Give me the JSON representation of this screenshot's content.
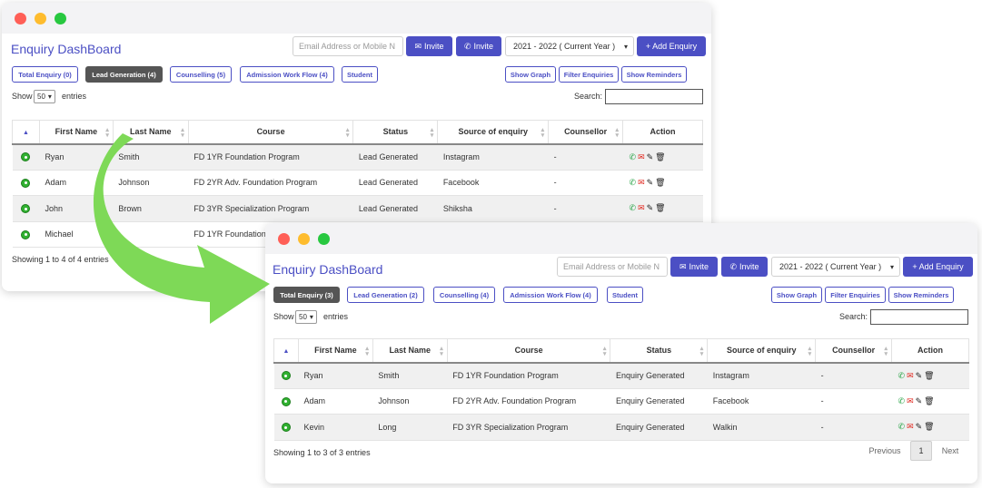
{
  "back": {
    "title": "Enquiry DashBoard",
    "email_placeholder": "Email Address or Mobile N",
    "invite_email_label": "Invite",
    "invite_whatsapp_label": "Invite",
    "year_select": "2021 - 2022 ( Current Year )",
    "add_label": "+ Add Enquiry",
    "tabs": [
      "Total Enquiry (0)",
      "Lead Generation (4)",
      "Counselling (5)",
      "Admission Work Flow (4)",
      "Student"
    ],
    "right_buttons": [
      "Show Graph",
      "Filter Enquiries",
      "Show Reminders"
    ],
    "show_label": "Show",
    "entries_select": "50",
    "entries_label": "entries",
    "search_label": "Search:",
    "columns": [
      "First Name",
      "Last Name",
      "Course",
      "Status",
      "Source of enquiry",
      "Counsellor",
      "Action"
    ],
    "rows": [
      {
        "first": "Ryan",
        "last": "Smith",
        "course": "FD 1YR Foundation Program",
        "status": "Lead Generated",
        "source": "Instagram",
        "counsellor": "-"
      },
      {
        "first": "Adam",
        "last": "Johnson",
        "course": "FD 2YR Adv. Foundation Program",
        "status": "Lead Generated",
        "source": "Facebook",
        "counsellor": "-"
      },
      {
        "first": "John",
        "last": "Brown",
        "course": "FD 3YR Specialization Program",
        "status": "Lead Generated",
        "source": "Shiksha",
        "counsellor": "-"
      },
      {
        "first": "Michael",
        "last": "",
        "course": "FD 1YR Foundation",
        "status": "",
        "source": "",
        "counsellor": ""
      }
    ],
    "footer": "Showing 1 to 4 of 4 entries"
  },
  "front": {
    "title": "Enquiry DashBoard",
    "email_placeholder": "Email Address or Mobile N",
    "invite_email_label": "Invite",
    "invite_whatsapp_label": "Invite",
    "year_select": "2021 - 2022 ( Current Year )",
    "add_label": "+ Add Enquiry",
    "tabs": [
      "Total Enquiry (3)",
      "Lead Generation (2)",
      "Counselling (4)",
      "Admission Work Flow (4)",
      "Student"
    ],
    "right_buttons": [
      "Show Graph",
      "Filter Enquiries",
      "Show Reminders"
    ],
    "show_label": "Show",
    "entries_select": "50",
    "entries_label": "entries",
    "search_label": "Search:",
    "columns": [
      "First Name",
      "Last Name",
      "Course",
      "Status",
      "Source of enquiry",
      "Counsellor",
      "Action"
    ],
    "rows": [
      {
        "first": "Ryan",
        "last": "Smith",
        "course": "FD 1YR Foundation Program",
        "status": "Enquiry Generated",
        "source": "Instagram",
        "counsellor": "-"
      },
      {
        "first": "Adam",
        "last": "Johnson",
        "course": "FD 2YR Adv. Foundation Program",
        "status": "Enquiry Generated",
        "source": "Facebook",
        "counsellor": "-"
      },
      {
        "first": "Kevin",
        "last": "Long",
        "course": "FD 3YR Specialization Program",
        "status": "Enquiry Generated",
        "source": "Walkin",
        "counsellor": "-"
      }
    ],
    "footer": "Showing 1 to 3 of 3 entries",
    "pager": {
      "previous": "Previous",
      "current": "1",
      "next": "Next"
    }
  },
  "colors": {
    "accent": "#4b4fc4",
    "arrow": "#7ed957",
    "active_tab": "#555555"
  }
}
